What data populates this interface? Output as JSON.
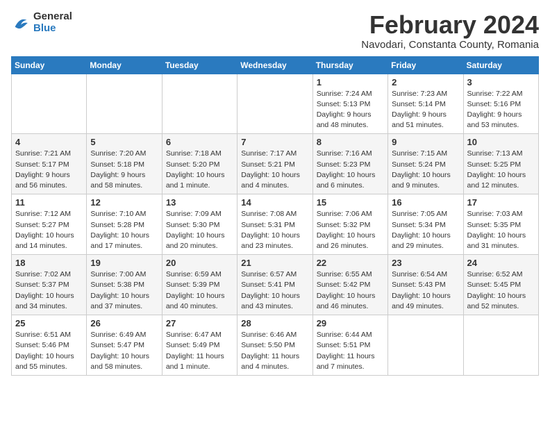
{
  "header": {
    "logo_general": "General",
    "logo_blue": "Blue",
    "month_title": "February 2024",
    "subtitle": "Navodari, Constanta County, Romania"
  },
  "days_of_week": [
    "Sunday",
    "Monday",
    "Tuesday",
    "Wednesday",
    "Thursday",
    "Friday",
    "Saturday"
  ],
  "weeks": [
    [
      {
        "day": "",
        "info": ""
      },
      {
        "day": "",
        "info": ""
      },
      {
        "day": "",
        "info": ""
      },
      {
        "day": "",
        "info": ""
      },
      {
        "day": "1",
        "info": "Sunrise: 7:24 AM\nSunset: 5:13 PM\nDaylight: 9 hours\nand 48 minutes."
      },
      {
        "day": "2",
        "info": "Sunrise: 7:23 AM\nSunset: 5:14 PM\nDaylight: 9 hours\nand 51 minutes."
      },
      {
        "day": "3",
        "info": "Sunrise: 7:22 AM\nSunset: 5:16 PM\nDaylight: 9 hours\nand 53 minutes."
      }
    ],
    [
      {
        "day": "4",
        "info": "Sunrise: 7:21 AM\nSunset: 5:17 PM\nDaylight: 9 hours\nand 56 minutes."
      },
      {
        "day": "5",
        "info": "Sunrise: 7:20 AM\nSunset: 5:18 PM\nDaylight: 9 hours\nand 58 minutes."
      },
      {
        "day": "6",
        "info": "Sunrise: 7:18 AM\nSunset: 5:20 PM\nDaylight: 10 hours\nand 1 minute."
      },
      {
        "day": "7",
        "info": "Sunrise: 7:17 AM\nSunset: 5:21 PM\nDaylight: 10 hours\nand 4 minutes."
      },
      {
        "day": "8",
        "info": "Sunrise: 7:16 AM\nSunset: 5:23 PM\nDaylight: 10 hours\nand 6 minutes."
      },
      {
        "day": "9",
        "info": "Sunrise: 7:15 AM\nSunset: 5:24 PM\nDaylight: 10 hours\nand 9 minutes."
      },
      {
        "day": "10",
        "info": "Sunrise: 7:13 AM\nSunset: 5:25 PM\nDaylight: 10 hours\nand 12 minutes."
      }
    ],
    [
      {
        "day": "11",
        "info": "Sunrise: 7:12 AM\nSunset: 5:27 PM\nDaylight: 10 hours\nand 14 minutes."
      },
      {
        "day": "12",
        "info": "Sunrise: 7:10 AM\nSunset: 5:28 PM\nDaylight: 10 hours\nand 17 minutes."
      },
      {
        "day": "13",
        "info": "Sunrise: 7:09 AM\nSunset: 5:30 PM\nDaylight: 10 hours\nand 20 minutes."
      },
      {
        "day": "14",
        "info": "Sunrise: 7:08 AM\nSunset: 5:31 PM\nDaylight: 10 hours\nand 23 minutes."
      },
      {
        "day": "15",
        "info": "Sunrise: 7:06 AM\nSunset: 5:32 PM\nDaylight: 10 hours\nand 26 minutes."
      },
      {
        "day": "16",
        "info": "Sunrise: 7:05 AM\nSunset: 5:34 PM\nDaylight: 10 hours\nand 29 minutes."
      },
      {
        "day": "17",
        "info": "Sunrise: 7:03 AM\nSunset: 5:35 PM\nDaylight: 10 hours\nand 31 minutes."
      }
    ],
    [
      {
        "day": "18",
        "info": "Sunrise: 7:02 AM\nSunset: 5:37 PM\nDaylight: 10 hours\nand 34 minutes."
      },
      {
        "day": "19",
        "info": "Sunrise: 7:00 AM\nSunset: 5:38 PM\nDaylight: 10 hours\nand 37 minutes."
      },
      {
        "day": "20",
        "info": "Sunrise: 6:59 AM\nSunset: 5:39 PM\nDaylight: 10 hours\nand 40 minutes."
      },
      {
        "day": "21",
        "info": "Sunrise: 6:57 AM\nSunset: 5:41 PM\nDaylight: 10 hours\nand 43 minutes."
      },
      {
        "day": "22",
        "info": "Sunrise: 6:55 AM\nSunset: 5:42 PM\nDaylight: 10 hours\nand 46 minutes."
      },
      {
        "day": "23",
        "info": "Sunrise: 6:54 AM\nSunset: 5:43 PM\nDaylight: 10 hours\nand 49 minutes."
      },
      {
        "day": "24",
        "info": "Sunrise: 6:52 AM\nSunset: 5:45 PM\nDaylight: 10 hours\nand 52 minutes."
      }
    ],
    [
      {
        "day": "25",
        "info": "Sunrise: 6:51 AM\nSunset: 5:46 PM\nDaylight: 10 hours\nand 55 minutes."
      },
      {
        "day": "26",
        "info": "Sunrise: 6:49 AM\nSunset: 5:47 PM\nDaylight: 10 hours\nand 58 minutes."
      },
      {
        "day": "27",
        "info": "Sunrise: 6:47 AM\nSunset: 5:49 PM\nDaylight: 11 hours\nand 1 minute."
      },
      {
        "day": "28",
        "info": "Sunrise: 6:46 AM\nSunset: 5:50 PM\nDaylight: 11 hours\nand 4 minutes."
      },
      {
        "day": "29",
        "info": "Sunrise: 6:44 AM\nSunset: 5:51 PM\nDaylight: 11 hours\nand 7 minutes."
      },
      {
        "day": "",
        "info": ""
      },
      {
        "day": "",
        "info": ""
      }
    ]
  ]
}
